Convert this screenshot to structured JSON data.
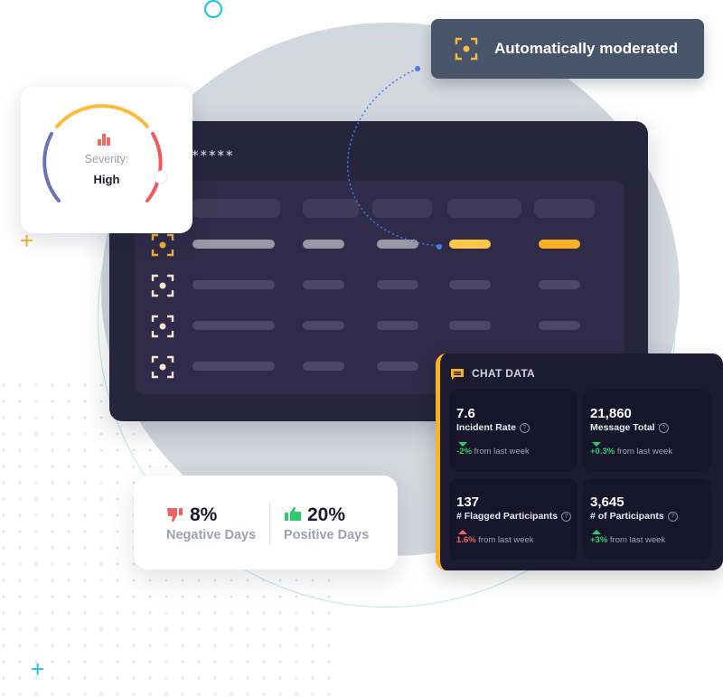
{
  "colors": {
    "accent_orange": "#fdb022",
    "accent_yellow": "#fec84b",
    "panel_dark": "#27253c",
    "toast_bg": "#48546a",
    "positive": "#2ecc71",
    "negative": "#f06262",
    "gauge_low": "#6b74b8",
    "gauge_mid": "#fbbc3a",
    "gauge_high": "#ef5a5f"
  },
  "severity_card": {
    "icon": "bar-chart-icon",
    "label": "Severity:",
    "value": "High"
  },
  "toast": {
    "icon": "focus-target-icon",
    "text": "Automatically moderated"
  },
  "moderation_panel": {
    "masked_text": "*****",
    "rows": [
      {
        "icon": "focus-target-icon",
        "highlighted": true
      },
      {
        "icon": "focus-target-icon",
        "highlighted": false
      },
      {
        "icon": "focus-target-icon",
        "highlighted": false
      },
      {
        "icon": "focus-target-icon",
        "highlighted": false
      }
    ]
  },
  "days_card": {
    "negative": {
      "icon": "thumbs-down-icon",
      "value": "8%",
      "label": "Negative Days"
    },
    "positive": {
      "icon": "thumbs-up-icon",
      "value": "20%",
      "label": "Positive Days"
    }
  },
  "chat_data": {
    "icon": "chat-icon",
    "title": "CHAT DATA",
    "stats": [
      {
        "value": "7.6",
        "label": "Incident Rate",
        "help": "?",
        "direction": "down",
        "change": "-2%",
        "change_tone": "positive",
        "suffix": "from last week"
      },
      {
        "value": "21,860",
        "label": "Message Total",
        "help": "?",
        "direction": "down",
        "change": "+0.3%",
        "change_tone": "positive",
        "suffix": "from last week"
      },
      {
        "value": "137",
        "label": "# Flagged Participants",
        "help": "?",
        "direction": "up",
        "change": "1.6%",
        "change_tone": "negative",
        "suffix": "from last week"
      },
      {
        "value": "3,645",
        "label": "# of Participants",
        "help": "?",
        "direction": "up",
        "change": "+3%",
        "change_tone": "positive",
        "suffix": "from last week"
      }
    ]
  }
}
